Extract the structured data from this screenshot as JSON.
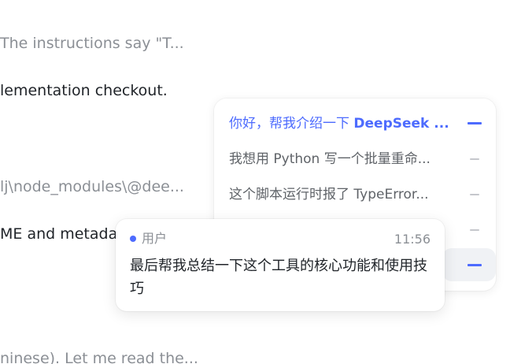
{
  "chat_background": {
    "lines": [
      "The instructions say \"T...",
      "lementation checkout.",
      "lj\\node_modules\\@dee...",
      "ME and metadata",
      "ninese). Let me read the..."
    ]
  },
  "outline": {
    "items": [
      {
        "label_prefix": "你好，帮我介绍一下 ",
        "label_emphasis": "DeepSeek ...",
        "active": true
      },
      {
        "label": "我想用 Python 写一个批量重命...",
        "active": false
      },
      {
        "label": "这个脚本运行时报了 TypeError...",
        "active": false
      },
      {
        "label": "",
        "active": false
      },
      {
        "label": "",
        "active": true
      }
    ]
  },
  "preview": {
    "role": "用户",
    "time": "11:56",
    "text": "最后帮我总结一下这个工具的核心功能和使用技巧"
  },
  "colors": {
    "accent": "#4d6bfe",
    "muted_text": "#8b8f95",
    "body_text": "#1f2328"
  }
}
